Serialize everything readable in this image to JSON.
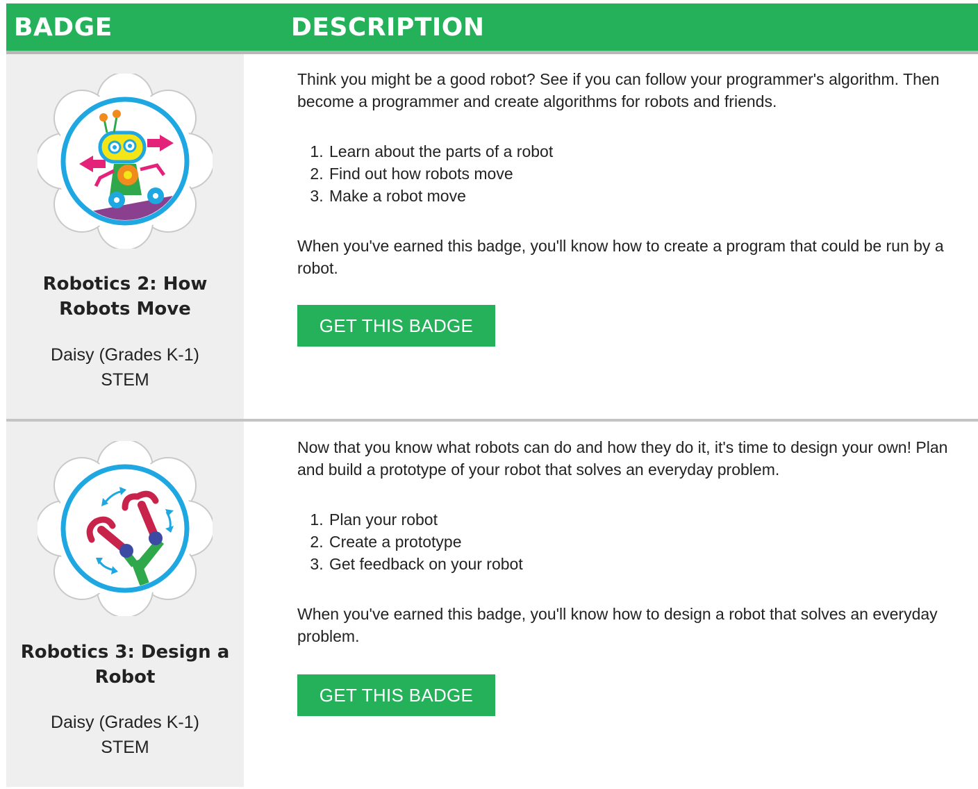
{
  "header": {
    "badge_label": "BADGE",
    "description_label": "DESCRIPTION"
  },
  "colors": {
    "accent": "#25b15a",
    "badge_bg": "#efefef",
    "ring": "#1ea7e1"
  },
  "badges": [
    {
      "title": "Robotics 2: How Robots Move",
      "level": "Daisy (Grades K-1)",
      "category": "STEM",
      "icon": "robot-moving-badge-icon",
      "intro": "Think you might be a good robot? See if you can follow your programmer's algorithm. Then become a programmer and create algorithms for robots and friends.",
      "steps": [
        "Learn about the parts of a robot",
        "Find out how robots move",
        "Make a robot move"
      ],
      "outro": "When you've earned this badge, you'll know how to create a program that could be run by a robot.",
      "button_label": "GET THIS BADGE"
    },
    {
      "title": "Robotics 3: Design a Robot",
      "level": "Daisy (Grades K-1)",
      "category": "STEM",
      "icon": "robot-arm-badge-icon",
      "intro": "Now that you know what robots can do and how they do it, it's time to design your own! Plan and build a prototype of your robot that solves an everyday problem.",
      "steps": [
        "Plan your robot",
        "Create a prototype",
        "Get feedback on your robot"
      ],
      "outro": "When you've earned this badge, you'll know how to design a robot that solves an everyday problem.",
      "button_label": "GET THIS BADGE"
    }
  ]
}
